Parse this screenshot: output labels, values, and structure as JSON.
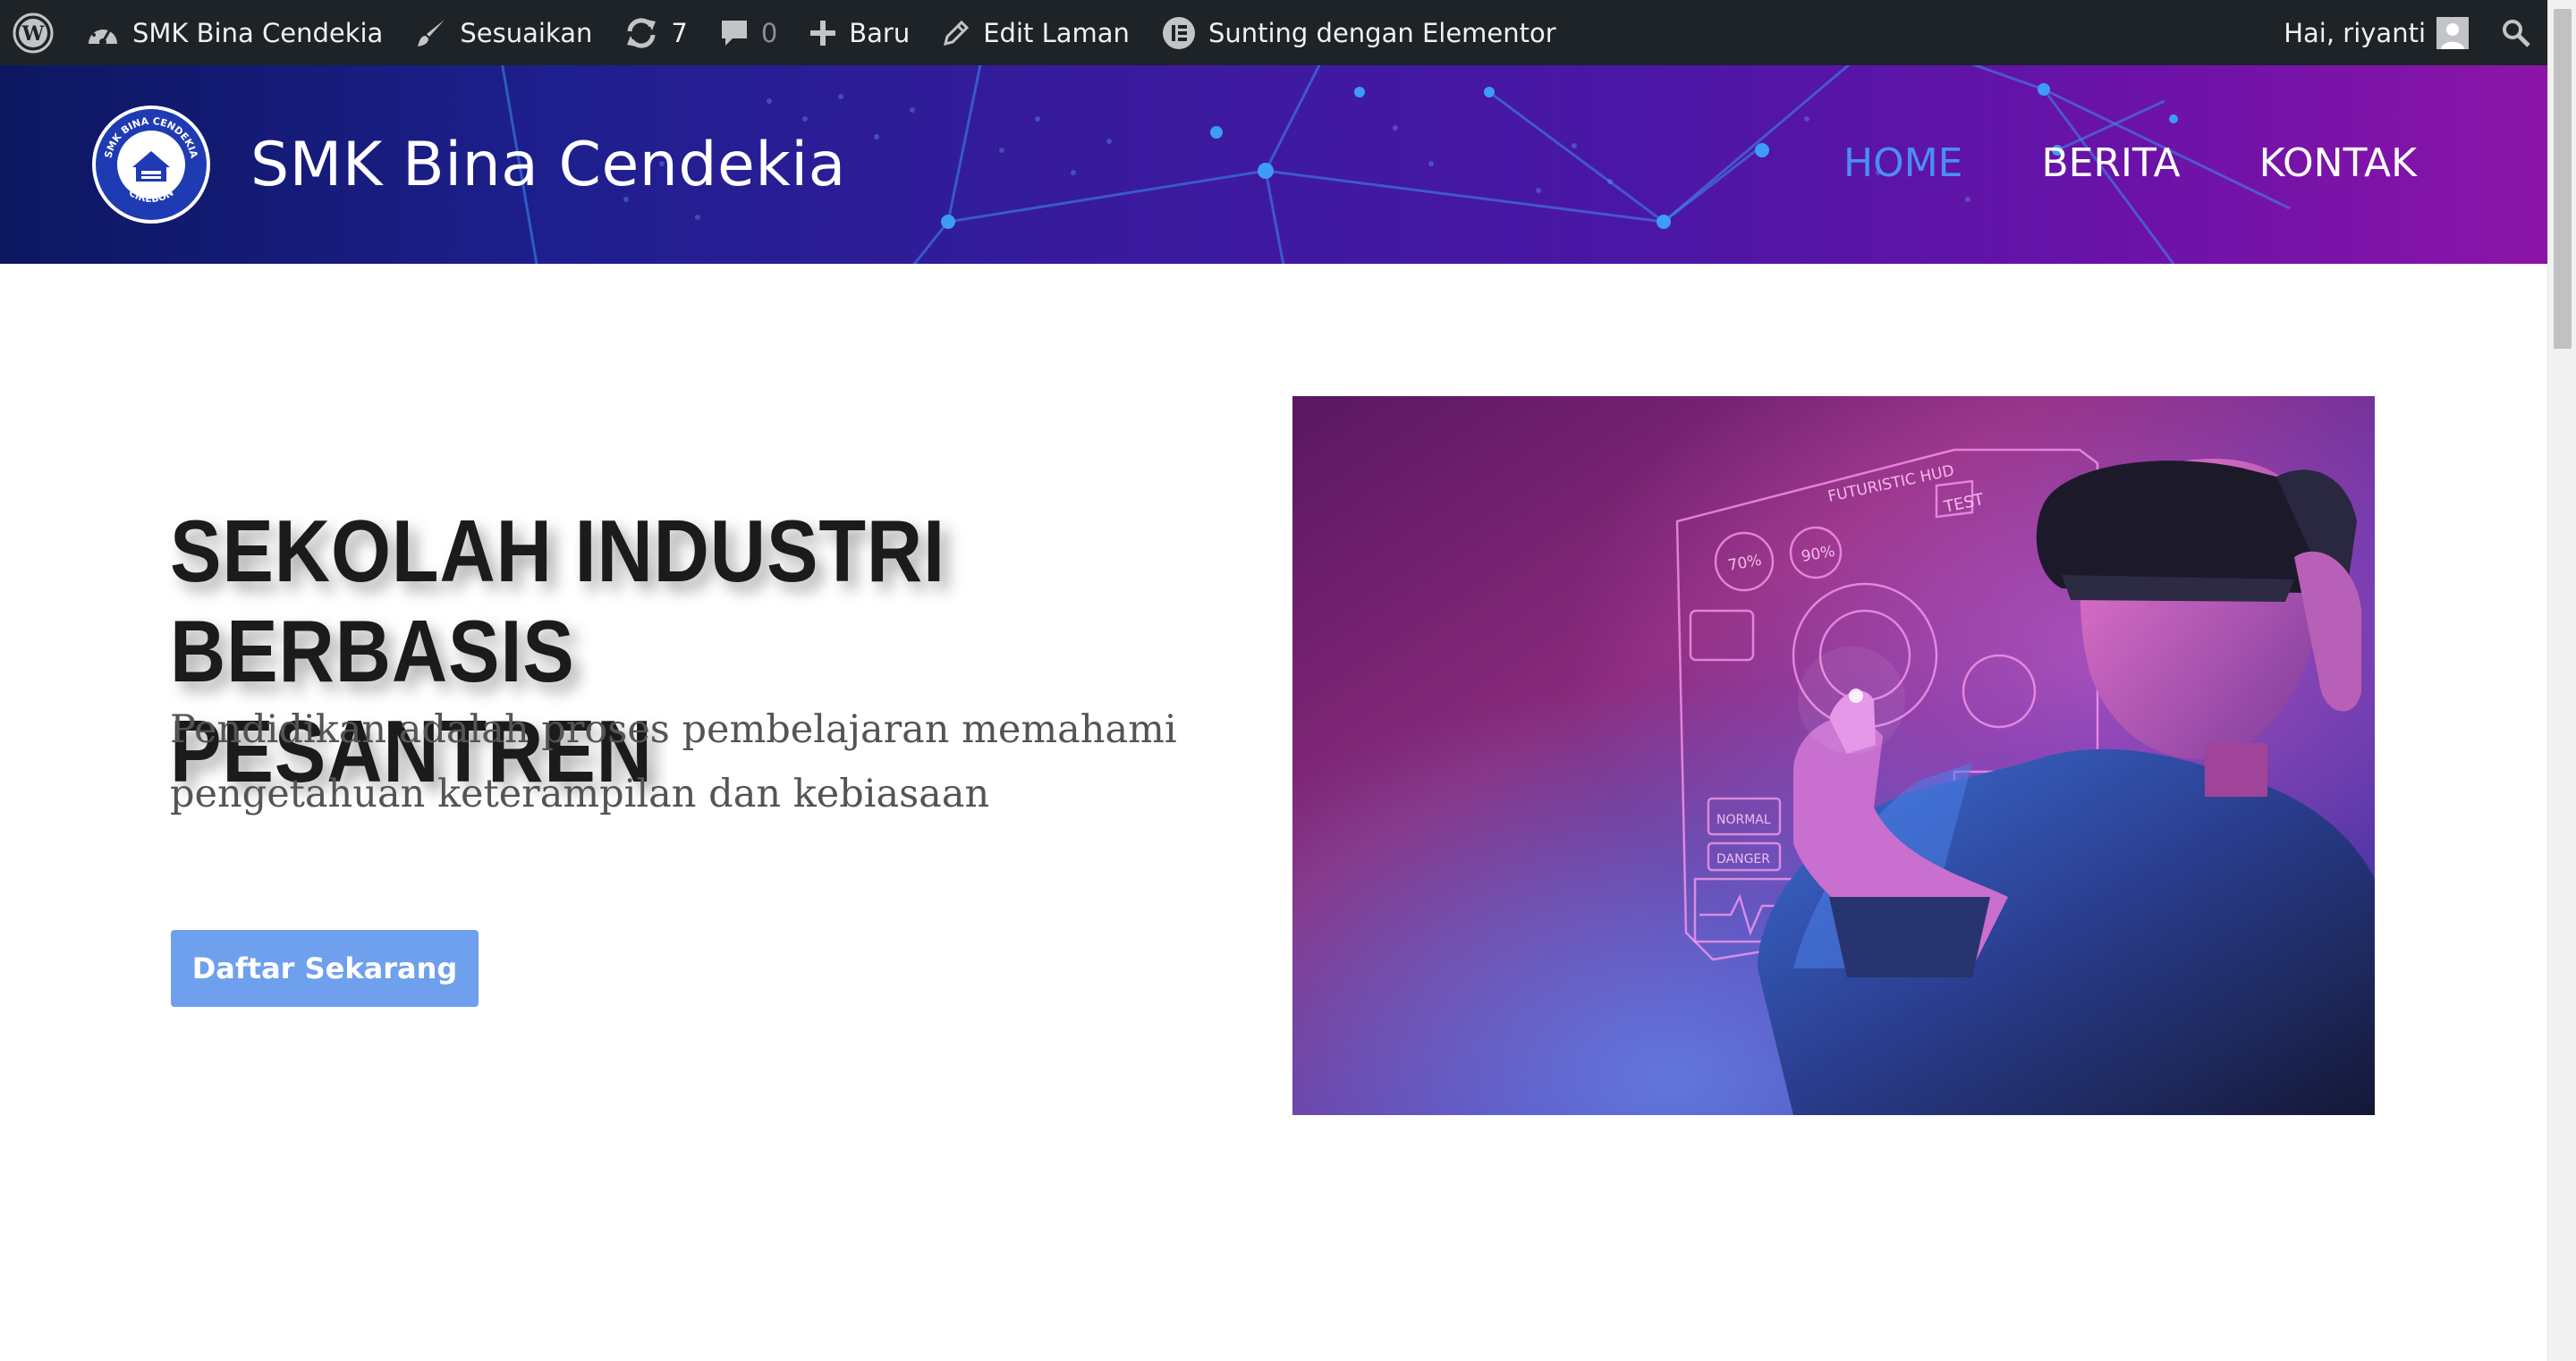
{
  "admin_bar": {
    "site_name": "SMK Bina Cendekia",
    "customize": "Sesuaikan",
    "updates_count": "7",
    "comments_count": "0",
    "new": "Baru",
    "edit_page": "Edit Laman",
    "elementor": "Sunting dengan Elementor",
    "greeting": "Hai, riyanti"
  },
  "header": {
    "logo_top_text": "SMK BINA CENDEKIA",
    "logo_bottom_text": "CIREBON",
    "site_title": "SMK Bina Cendekia",
    "nav": [
      {
        "label": "HOME",
        "active": true
      },
      {
        "label": "BERITA",
        "active": false
      },
      {
        "label": "KONTAK",
        "active": false
      }
    ]
  },
  "hero": {
    "title_line1": "SEKOLAH INDUSTRI BERBASIS",
    "title_line2": "PESANTREN",
    "subtitle_line1": "Pendidikan adalah proses pembelajaran memahami",
    "subtitle_line2": "pengetahuan keterampilan dan kebiasaan",
    "cta_label": "Daftar Sekarang",
    "image_labels": {
      "hud_title": "FUTURISTIC HUD",
      "test": "TEST",
      "p70": "70%",
      "p90": "90%",
      "normal": "NORMAL",
      "danger": "DANGER"
    }
  },
  "colors": {
    "admin_bar_bg": "#1d2327",
    "nav_active": "#4a8ef5",
    "cta_bg": "#6fa0ee",
    "title_text": "#1b1b1b"
  }
}
